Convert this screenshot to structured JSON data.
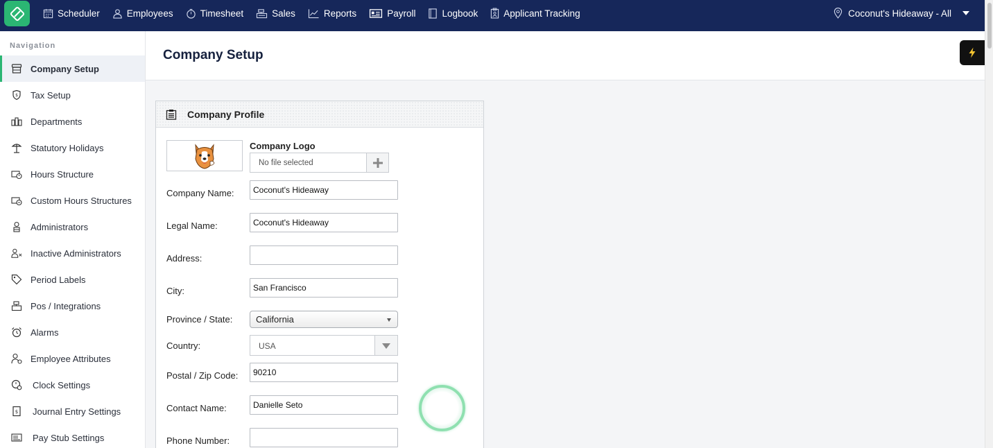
{
  "topnav": {
    "items": [
      {
        "label": "Scheduler",
        "icon": "calendar-icon"
      },
      {
        "label": "Employees",
        "icon": "user-icon"
      },
      {
        "label": "Timesheet",
        "icon": "stopwatch-icon"
      },
      {
        "label": "Sales",
        "icon": "register-icon"
      },
      {
        "label": "Reports",
        "icon": "chart-icon"
      },
      {
        "label": "Payroll",
        "icon": "id-card-icon"
      },
      {
        "label": "Logbook",
        "icon": "book-icon"
      },
      {
        "label": "Applicant Tracking",
        "icon": "clipboard-icon"
      }
    ],
    "location": "Coconut's Hideaway - All"
  },
  "sidebar": {
    "heading": "Navigation",
    "items": [
      {
        "label": "Company Setup",
        "icon": "store-icon",
        "active": true
      },
      {
        "label": "Tax Setup",
        "icon": "tax-icon"
      },
      {
        "label": "Departments",
        "icon": "departments-icon"
      },
      {
        "label": "Statutory Holidays",
        "icon": "holiday-icon"
      },
      {
        "label": "Hours Structure",
        "icon": "hours-icon"
      },
      {
        "label": "Custom Hours Structures",
        "icon": "custom-hours-icon"
      },
      {
        "label": "Administrators",
        "icon": "admin-icon"
      },
      {
        "label": "Inactive Administrators",
        "icon": "inactive-admin-icon"
      },
      {
        "label": "Period Labels",
        "icon": "tag-icon"
      },
      {
        "label": "Pos / Integrations",
        "icon": "pos-icon"
      },
      {
        "label": "Alarms",
        "icon": "alarm-icon"
      },
      {
        "label": "Employee Attributes",
        "icon": "attributes-icon"
      },
      {
        "label": "Clock Settings",
        "icon": "clock-settings-icon"
      },
      {
        "label": "Journal Entry Settings",
        "icon": "journal-icon"
      },
      {
        "label": "Pay Stub Settings",
        "icon": "paystub-icon"
      }
    ]
  },
  "page": {
    "title": "Company Setup"
  },
  "profile": {
    "title": "Company Profile",
    "logo_label": "Company Logo",
    "file_status": "No file selected",
    "fields": {
      "company_name": {
        "label": "Company Name:",
        "value": "Coconut's Hideaway"
      },
      "legal_name": {
        "label": "Legal Name:",
        "value": "Coconut's Hideaway"
      },
      "address": {
        "label": "Address:",
        "value": ""
      },
      "city": {
        "label": "City:",
        "value": "San Francisco"
      },
      "province": {
        "label": "Province / State:",
        "value": "California"
      },
      "country": {
        "label": "Country:",
        "value": "USA"
      },
      "postal": {
        "label": "Postal / Zip Code:",
        "value": "90210"
      },
      "contact": {
        "label": "Contact Name:",
        "value": "Danielle Seto"
      },
      "phone": {
        "label": "Phone Number:",
        "value": ""
      }
    }
  },
  "colors": {
    "nav_bg": "#16275a",
    "brand": "#2bb673",
    "active_bar": "#2bb673"
  }
}
